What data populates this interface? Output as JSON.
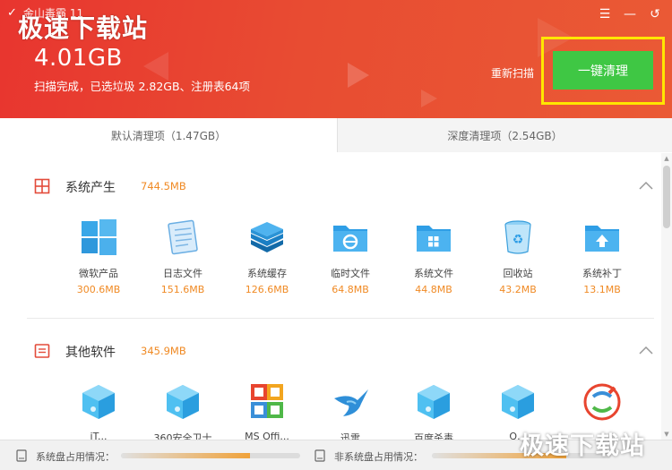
{
  "header": {
    "app_title": "金山毒霸 11",
    "watermark": "极速下载站",
    "total_size": "4.01GB",
    "summary": "扫描完成，已选垃圾 2.82GB、注册表64项",
    "rescan_label": "重新扫描",
    "clean_label": "一键清理",
    "menu_icon": "☰",
    "min_icon": "—",
    "back_icon": "↺"
  },
  "tabs": [
    {
      "label": "默认清理项（1.47GB）",
      "active": true
    },
    {
      "label": "深度清理项（2.54GB）",
      "active": false
    }
  ],
  "sections": [
    {
      "title": "系统产生",
      "size": "744.5MB",
      "icon": "windows-grid-icon",
      "items": [
        {
          "label": "微软产品",
          "size": "300.6MB",
          "icon": "windows-logo-icon"
        },
        {
          "label": "日志文件",
          "size": "151.6MB",
          "icon": "notepad-icon"
        },
        {
          "label": "系统缓存",
          "size": "126.6MB",
          "icon": "layers-icon"
        },
        {
          "label": "临时文件",
          "size": "64.8MB",
          "icon": "folder-ie-icon"
        },
        {
          "label": "系统文件",
          "size": "44.8MB",
          "icon": "folder-windows-icon"
        },
        {
          "label": "回收站",
          "size": "43.2MB",
          "icon": "recycle-bin-icon"
        },
        {
          "label": "系统补丁",
          "size": "13.1MB",
          "icon": "folder-upload-icon"
        }
      ]
    },
    {
      "title": "其他软件",
      "size": "345.9MB",
      "icon": "list-window-icon",
      "items": [
        {
          "label": "iT...",
          "icon": "box-cube-icon"
        },
        {
          "label": "360安全卫士",
          "icon": "box-cube-icon"
        },
        {
          "label": "MS Offi...",
          "icon": "office-logo-icon"
        },
        {
          "label": "迅雷",
          "icon": "thunder-bird-icon"
        },
        {
          "label": "百度杀毒",
          "icon": "box-cube-icon"
        },
        {
          "label": "Q...",
          "icon": "box-cube-icon"
        },
        {
          "label": "",
          "icon": "sogou-logo-icon"
        }
      ]
    }
  ],
  "footer": {
    "system_disk_label": "系统盘占用情况：",
    "system_disk_fill": 0.72,
    "other_disk_label": "非系统盘占用情况：",
    "other_disk_fill": 0.75,
    "watermark": "极速下载站"
  },
  "colors": {
    "header_red": "#e8352f",
    "clean_green": "#3fc744",
    "highlight_yellow": "#ffe600",
    "size_orange": "#f08a24"
  }
}
